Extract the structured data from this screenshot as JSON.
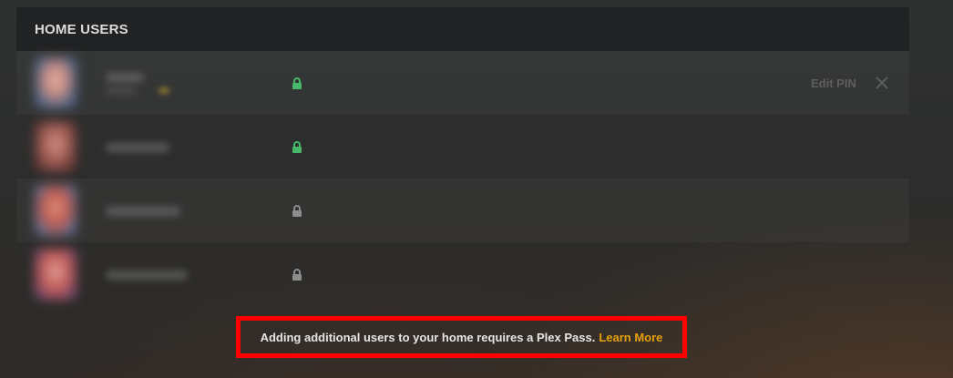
{
  "header": {
    "title": "HOME USERS"
  },
  "users": [
    {
      "lock_color": "#46b86a",
      "lock_state": "locked",
      "action_label": "Edit PIN",
      "close_icon": "close-icon"
    },
    {
      "lock_color": "#46b86a",
      "lock_state": "locked"
    },
    {
      "lock_color": "#8d8d8d",
      "lock_state": "unlocked"
    },
    {
      "lock_color": "#8d8d8d",
      "lock_state": "unlocked"
    }
  ],
  "notice": {
    "text": "Adding additional users to your home requires a Plex Pass.",
    "link_label": "Learn More",
    "link_color": "#e5a00d",
    "highlight_color": "#ff0000"
  }
}
